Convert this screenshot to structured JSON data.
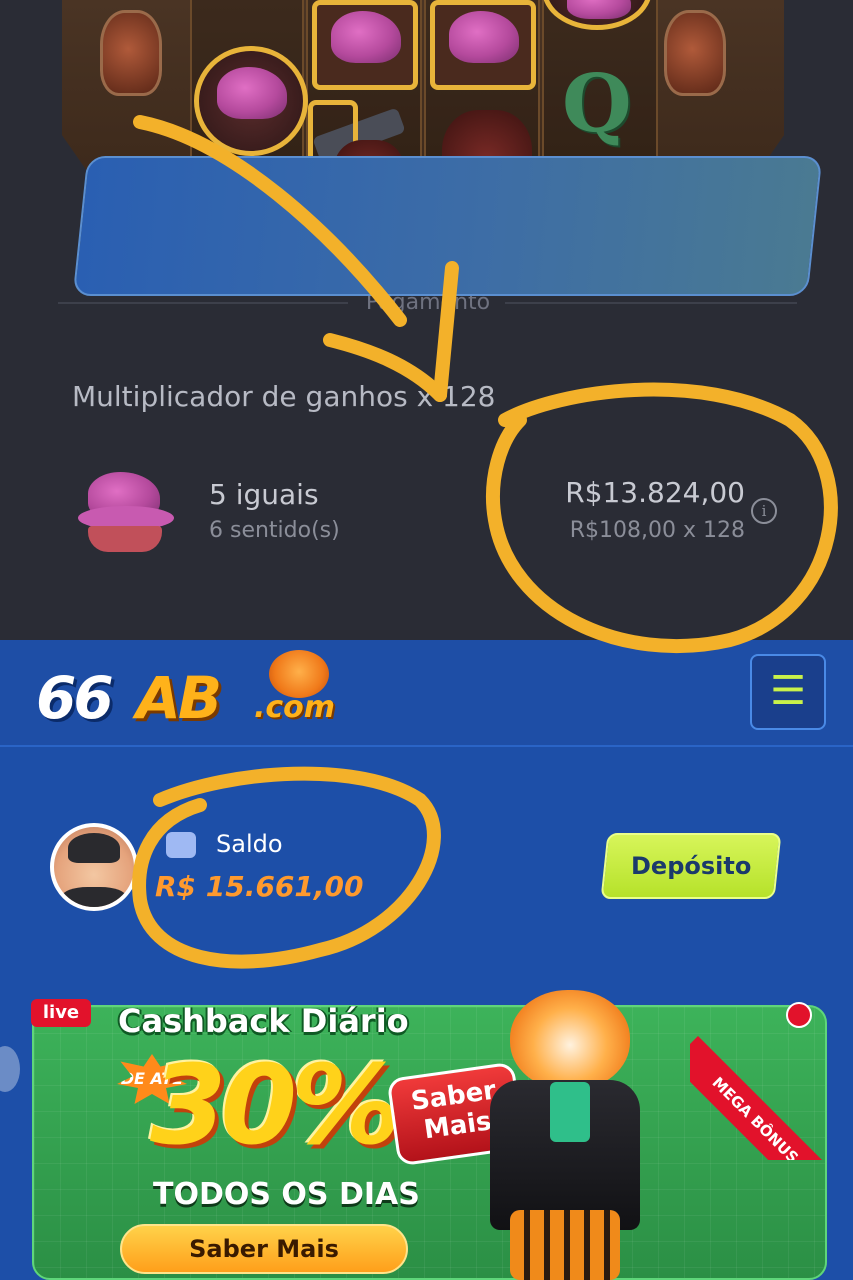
{
  "paytable": {
    "section_title": "Pagamento",
    "multiplier_text": "Multiplicador de ganhos x 128",
    "symbol_name": "5 iguais",
    "symbol_ways": "6 sentido(s)",
    "win_amount": "R$13.824,00",
    "win_calc": "R$108,00 x 128",
    "info_icon": "i"
  },
  "app": {
    "logo_66": "66",
    "logo_ab": "AB",
    "logo_com": ".com",
    "menu_icon": "☰",
    "balance_label": "Saldo",
    "balance_value": "R$ 15.661,00",
    "deposit_label": "Depósito"
  },
  "banner": {
    "live_label": "live",
    "title": "Cashback Diário",
    "prefix": "DE ATÉ",
    "percent": "30%",
    "subtitle": "TODOS OS DIAS",
    "cta_label": "Saber Mais",
    "badge_label_1": "Saber",
    "badge_label_2": "Mais",
    "ribbon_label": "MEGA BÔNUS"
  },
  "colors": {
    "dark_bg": "#2a2c35",
    "app_blue": "#1d4fa8",
    "deposit_green": "#c5ea3a",
    "balance_orange": "#ff9a2e",
    "annotation_yellow": "#f3b12a"
  }
}
